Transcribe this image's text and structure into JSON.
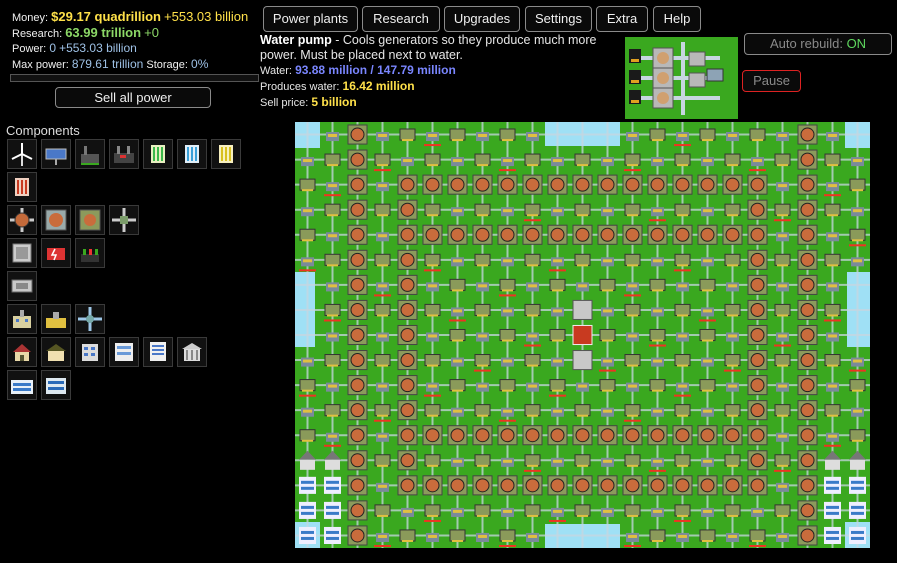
{
  "stats": {
    "money_label": "Money:",
    "money_value": "$29.17 quadrillion",
    "money_rate": "+553.03 billion",
    "research_label": "Research:",
    "research_value": "63.99 trillion",
    "research_rate": "+0",
    "power_label": "Power:",
    "power_value": "0",
    "power_rate": "+553.03 billion",
    "maxpower_label": "Max power:",
    "maxpower_value": "879.61 trillion",
    "storage_label": "Storage:",
    "storage_value": "0%",
    "storage_fraction": 0
  },
  "sell_label": "Sell all power",
  "tabs": [
    "Power plants",
    "Research",
    "Upgrades",
    "Settings",
    "Extra",
    "Help"
  ],
  "auto_rebuild": {
    "label": "Auto rebuild:",
    "state": "ON"
  },
  "pause_label": "Pause",
  "info": {
    "title": "Water pump",
    "desc": " - Cools generators so they produce much more power. Must be placed next to water.",
    "water_label": "Water:",
    "water_value": "93.88 million / 147.79 million",
    "produces_label": "Produces water:",
    "produces_value": "16.42 million",
    "sell_label": "Sell price:",
    "sell_value": "5 billion"
  },
  "components_title": "Components",
  "palette_rows": [
    [
      "wind-turbine",
      "solar-panel",
      "coal-plant",
      "gas-plant",
      "uranium-rod-green",
      "cell-blue",
      "cell-yellow"
    ],
    [
      "cell-red"
    ],
    [
      "heat-exchanger",
      "water-pump",
      "ground-pump",
      "pipe-valve"
    ],
    [
      "battery",
      "generator-red",
      "generator-green"
    ],
    [
      "storage-unit"
    ],
    [
      "office-small",
      "office-yellow",
      "pipe-cross"
    ],
    [
      "house",
      "house-2",
      "apartment",
      "apartment-2",
      "office-tower",
      "bank"
    ],
    [
      "factory-blue",
      "factory-2"
    ]
  ],
  "colors": {
    "grass": "#3aa81f",
    "water": "#9fe0f5",
    "money": "#ffe14a",
    "research": "#8cd867",
    "water_text": "#7a86ff",
    "pause_border": "#dd2222",
    "auto_on": "#5fd85f"
  }
}
